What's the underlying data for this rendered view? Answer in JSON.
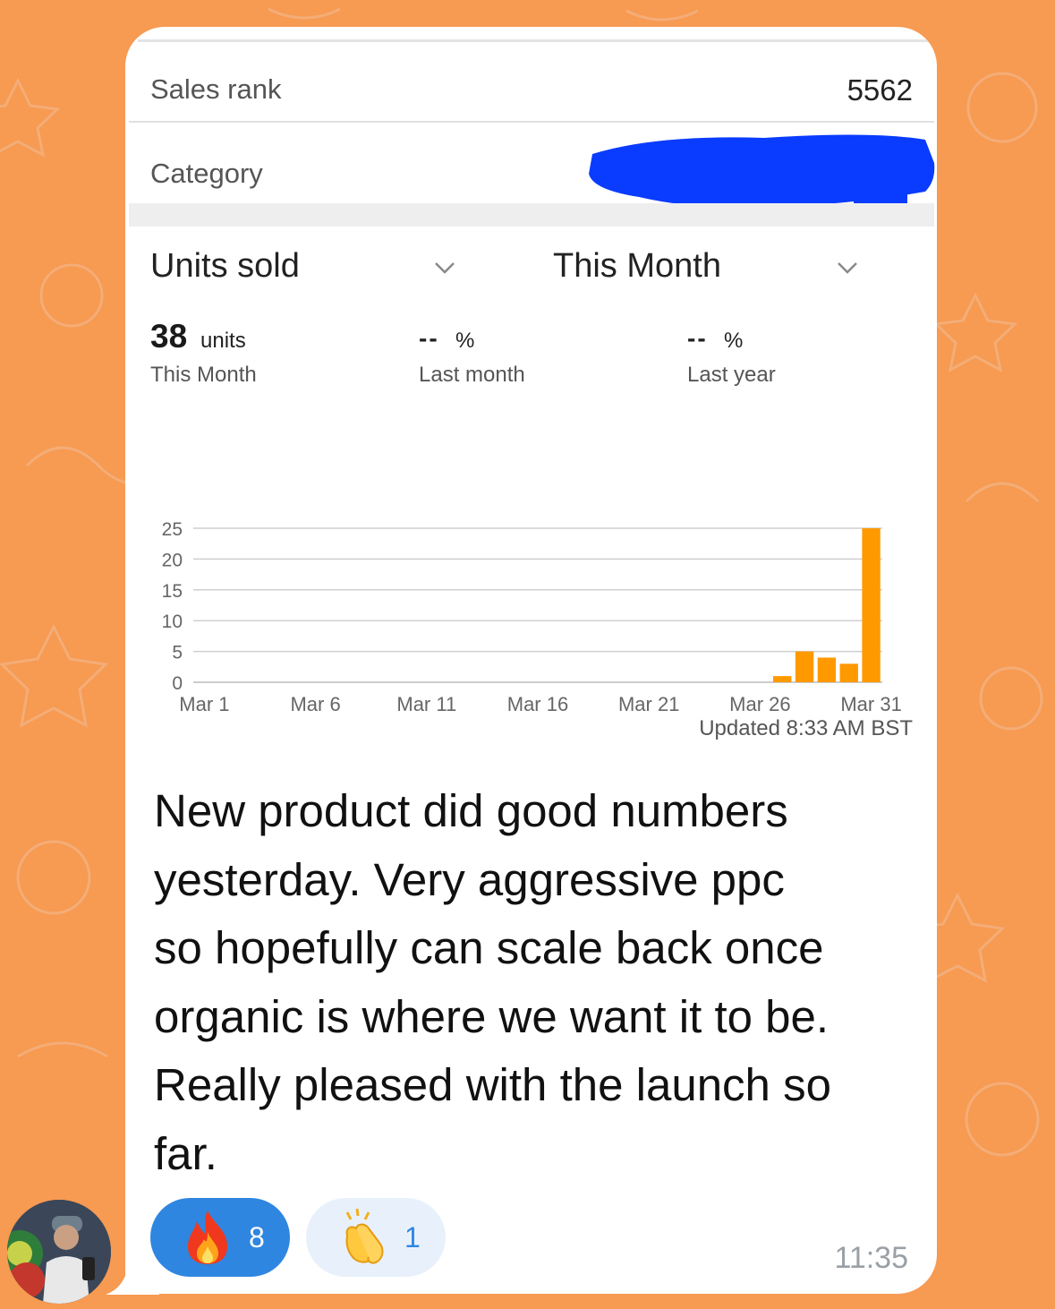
{
  "details": {
    "sales_rank_label": "Sales rank",
    "sales_rank_value": "5562",
    "category_label": "Category"
  },
  "filters": {
    "metric": "Units sold",
    "period": "This Month"
  },
  "stats": {
    "primary_value": "38",
    "primary_unit": "units",
    "primary_caption": "This Month",
    "last_month_value": "--",
    "last_month_unit": "%",
    "last_month_caption": "Last month",
    "last_year_value": "--",
    "last_year_unit": "%",
    "last_year_caption": "Last year"
  },
  "chart_data": {
    "type": "bar",
    "title": "",
    "xlabel": "",
    "ylabel": "",
    "y_ticks": [
      "25",
      "20",
      "15",
      "10",
      "5",
      "0"
    ],
    "x_ticks": [
      "Mar 1",
      "Mar 6",
      "Mar 11",
      "Mar 16",
      "Mar 21",
      "Mar 26",
      "Mar 31"
    ],
    "ylim": [
      0,
      25
    ],
    "grid": true,
    "bar_color": "#ff9900",
    "categories": [
      "Mar 27",
      "Mar 28",
      "Mar 29",
      "Mar 30",
      "Mar 31"
    ],
    "values": [
      1,
      5,
      4,
      3,
      25
    ]
  },
  "updated_text": "Updated 8:33 AM BST",
  "message": {
    "lines": [
      "New product did good numbers",
      "yesterday. Very aggressive ppc",
      "so hopefully can scale back once",
      "organic is where we want it to be.",
      "Really pleased with the launch so",
      "far."
    ],
    "time": "11:35"
  },
  "reactions": [
    {
      "icon": "fire-icon",
      "count": "8"
    },
    {
      "icon": "clapping-hands-icon",
      "count": "1"
    }
  ],
  "colors": {
    "background": "#f79a52",
    "bubble": "#ffffff",
    "bar": "#ff9900",
    "reaction_active": "#2f86e0",
    "reaction_inactive": "#e8f1fb",
    "redaction": "#0a3cff"
  }
}
